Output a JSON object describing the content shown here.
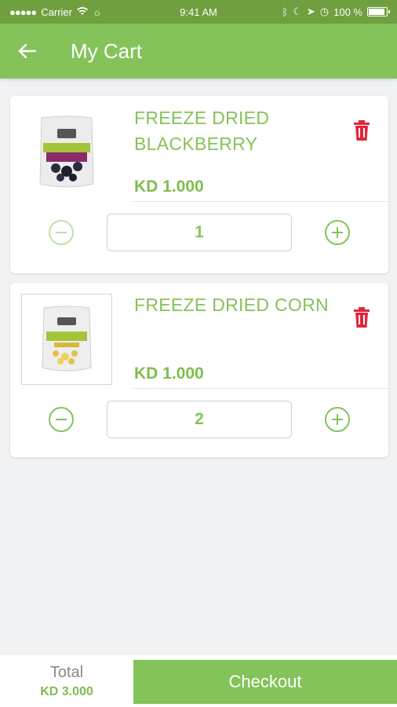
{
  "status_bar": {
    "carrier": "Carrier",
    "time": "9:41 AM",
    "battery": "100 %"
  },
  "header": {
    "title": "My Cart",
    "back_icon": "arrow-left-icon"
  },
  "cart": {
    "items": [
      {
        "name": "FREEZE DRIED BLACKBERRY",
        "price": "KD 1.000",
        "quantity": "1",
        "minus_state": "disabled"
      },
      {
        "name": "FREEZE DRIED CORN",
        "price": "KD 1.000",
        "quantity": "2",
        "minus_state": "enabled"
      }
    ]
  },
  "footer": {
    "total_label": "Total",
    "total_value": "KD 3.000",
    "checkout_label": "Checkout"
  },
  "colors": {
    "brand_green": "#84c35a",
    "status_green": "#6f9f3e",
    "delete_red": "#e0263c"
  }
}
